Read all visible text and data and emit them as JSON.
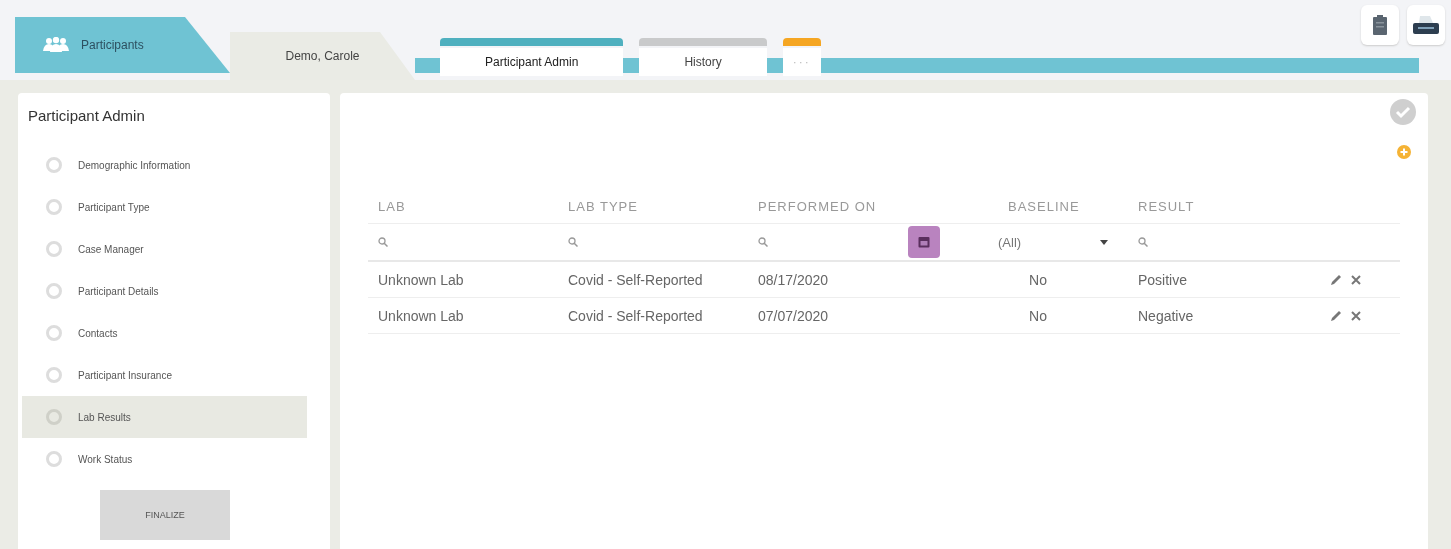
{
  "main_tabs": [
    {
      "label": "Participants",
      "kind": "home",
      "selected": true
    },
    {
      "label": "Demo, Carole",
      "kind": "record",
      "selected": false
    }
  ],
  "sub_tabs": [
    {
      "label": "Participant Admin",
      "color": "#4fb0bf",
      "selected": true
    },
    {
      "label": "History",
      "color": "#c9cacb",
      "selected": false
    },
    {
      "label": "···",
      "color": "#f5a623",
      "selected": false
    }
  ],
  "sidebar": {
    "title": "Participant Admin",
    "items": [
      {
        "label": "Demographic Information",
        "selected": false
      },
      {
        "label": "Participant Type",
        "selected": false
      },
      {
        "label": "Case Manager",
        "selected": false
      },
      {
        "label": "Participant Details",
        "selected": false
      },
      {
        "label": "Contacts",
        "selected": false
      },
      {
        "label": "Participant Insurance",
        "selected": false
      },
      {
        "label": "Lab Results",
        "selected": true
      },
      {
        "label": "Work Status",
        "selected": false
      }
    ],
    "finalize": "FINALIZE"
  },
  "table": {
    "columns": [
      {
        "label": "LAB",
        "kind": "search"
      },
      {
        "label": "LAB TYPE",
        "kind": "search"
      },
      {
        "label": "PERFORMED ON",
        "kind": "date"
      },
      {
        "label": "BASELINE",
        "kind": "select",
        "value": "(All)"
      },
      {
        "label": "RESULT",
        "kind": "search"
      }
    ],
    "rows": [
      {
        "cells": [
          "Unknown Lab",
          "Covid - Self-Reported",
          "08/17/2020",
          "No",
          "Positive"
        ]
      },
      {
        "cells": [
          "Unknown Lab",
          "Covid - Self-Reported",
          "07/07/2020",
          "No",
          "Negative"
        ]
      }
    ]
  }
}
